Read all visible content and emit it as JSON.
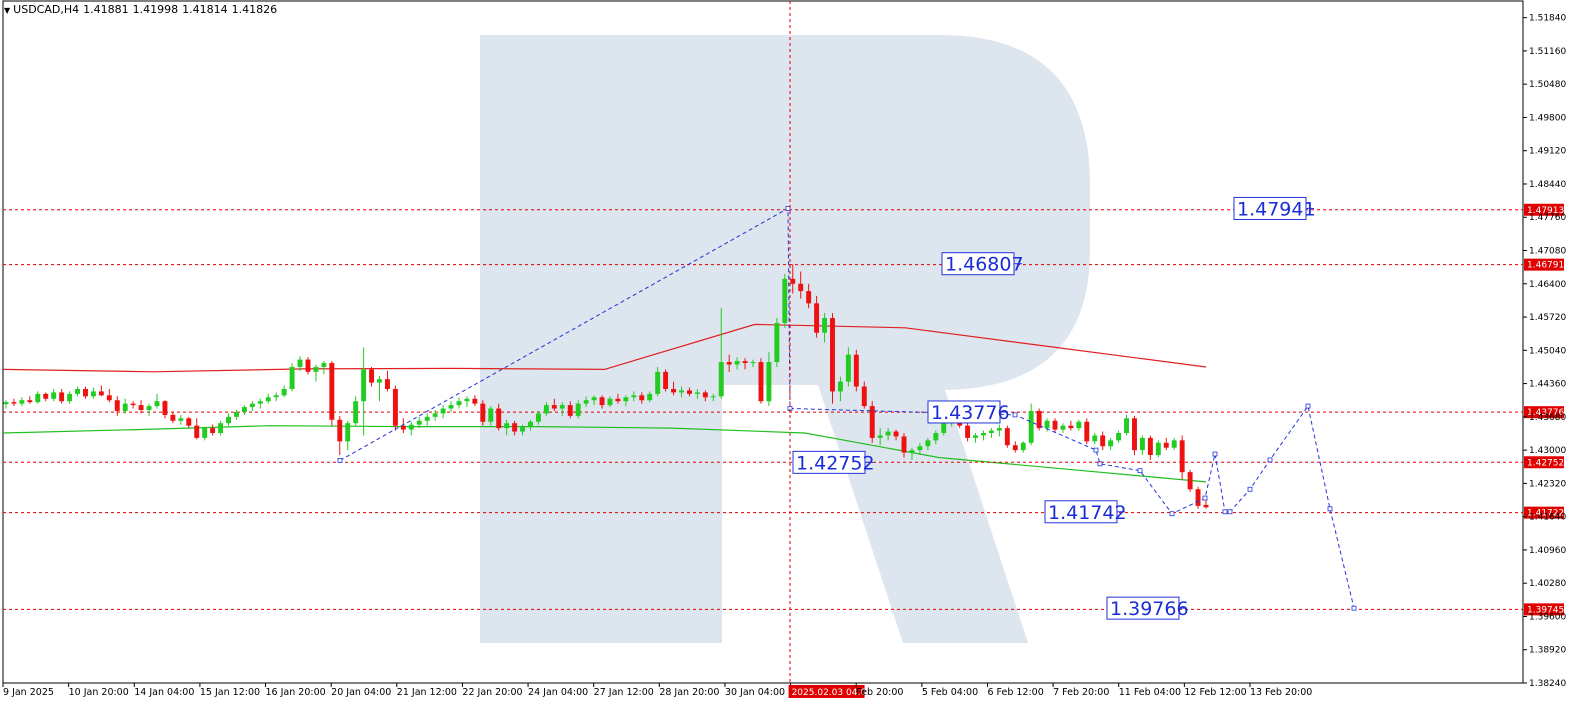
{
  "header": {
    "symbol": "USDCAD,H4",
    "open": "1.41881",
    "high": "1.41998",
    "low": "1.41814",
    "close": "1.41826"
  },
  "chart_data": {
    "type": "candlestick",
    "symbol": "USDCAD",
    "timeframe": "H4",
    "ylim": [
      1.3824,
      1.5218
    ],
    "y_ticks": [
      "1.51840",
      "1.51160",
      "1.50480",
      "1.49800",
      "1.49120",
      "1.48440",
      "1.47760",
      "1.47080",
      "1.46400",
      "1.45720",
      "1.45040",
      "1.44360",
      "1.43680",
      "1.43000",
      "1.42320",
      "1.41640",
      "1.40960",
      "1.40280",
      "1.39600",
      "1.38920",
      "1.38240"
    ],
    "x_ticks": [
      "9 Jan 2025",
      "10 Jan 20:00",
      "14 Jan 04:00",
      "15 Jan 12:00",
      "16 Jan 20:00",
      "20 Jan 04:00",
      "21 Jan 12:00",
      "22 Jan 20:00",
      "24 Jan 04:00",
      "27 Jan 12:00",
      "28 Jan 20:00",
      "30 Jan 04:00",
      "2025.02.03 04:00",
      "Feb 20:00",
      "5 Feb 04:00",
      "6 Feb 12:00",
      "7 Feb 20:00",
      "11 Feb 04:00",
      "12 Feb 12:00",
      "13 Feb 20:00"
    ],
    "crosshair_time": "2025.02.03 04:00",
    "horizontal_levels": [
      {
        "price": 1.47913,
        "tag": "1.47913"
      },
      {
        "price": 1.46791,
        "tag": "1.46791"
      },
      {
        "price": 1.43776,
        "tag": "1.43776"
      },
      {
        "price": 1.42752,
        "tag": "1.42752"
      },
      {
        "price": 1.41722,
        "tag": "1.41722"
      },
      {
        "price": 1.39745,
        "tag": "1.39745"
      }
    ],
    "annotations": [
      {
        "label": "1.47941",
        "price": 1.4794
      },
      {
        "label": "1.46807",
        "price": 1.4681
      },
      {
        "label": "1.43776",
        "price": 1.4378
      },
      {
        "label": "1.42752",
        "price": 1.4275
      },
      {
        "label": "1.41742",
        "price": 1.4174
      },
      {
        "label": "1.39766",
        "price": 1.3977
      }
    ],
    "forecast_path": [
      1.4279,
      1.4794,
      1.4385,
      1.4372,
      1.43,
      1.4272,
      1.4258,
      1.417,
      1.4202,
      1.4292,
      1.4174,
      1.4174,
      1.422,
      1.428,
      1.439,
      1.418,
      1.3977
    ],
    "moving_averages": [
      {
        "color": "#e02020",
        "values": [
          1.4465,
          1.446,
          1.4466,
          1.4467,
          1.4465,
          1.4557,
          1.455,
          1.451,
          1.447
        ]
      },
      {
        "color": "#1fbf1f",
        "values": [
          1.4335,
          1.4342,
          1.435,
          1.4348,
          1.4348,
          1.4345,
          1.4335,
          1.4285,
          1.426,
          1.4235
        ]
      }
    ],
    "colors": {
      "bull": "#22cc22",
      "bear": "#ee1111",
      "level": "#e00000",
      "forecast": "#2233dd",
      "crosshair": "#e00000",
      "watermark": "#dde5ef"
    },
    "candles": [
      [
        1.4394,
        1.4402,
        1.4385,
        1.4398
      ],
      [
        1.4398,
        1.4405,
        1.439,
        1.4395
      ],
      [
        1.4395,
        1.4408,
        1.439,
        1.4402
      ],
      [
        1.4402,
        1.441,
        1.4395,
        1.4398
      ],
      [
        1.4398,
        1.442,
        1.4395,
        1.4415
      ],
      [
        1.4415,
        1.4418,
        1.44,
        1.4405
      ],
      [
        1.4405,
        1.4425,
        1.44,
        1.4418
      ],
      [
        1.4418,
        1.4425,
        1.4395,
        1.44
      ],
      [
        1.44,
        1.442,
        1.4395,
        1.4415
      ],
      [
        1.4415,
        1.443,
        1.441,
        1.4425
      ],
      [
        1.4425,
        1.443,
        1.4405,
        1.441
      ],
      [
        1.441,
        1.4428,
        1.4405,
        1.442
      ],
      [
        1.442,
        1.4432,
        1.441,
        1.4412
      ],
      [
        1.4412,
        1.4425,
        1.4398,
        1.4402
      ],
      [
        1.4402,
        1.441,
        1.437,
        1.438
      ],
      [
        1.438,
        1.4405,
        1.4375,
        1.4395
      ],
      [
        1.4395,
        1.44,
        1.4385,
        1.4392
      ],
      [
        1.4392,
        1.4402,
        1.4375,
        1.4382
      ],
      [
        1.4382,
        1.4395,
        1.437,
        1.439
      ],
      [
        1.439,
        1.4415,
        1.4385,
        1.44
      ],
      [
        1.44,
        1.4402,
        1.4365,
        1.4372
      ],
      [
        1.4372,
        1.4378,
        1.4355,
        1.436
      ],
      [
        1.436,
        1.4372,
        1.4352,
        1.4365
      ],
      [
        1.4365,
        1.4368,
        1.4345,
        1.435
      ],
      [
        1.435,
        1.4365,
        1.4322,
        1.4325
      ],
      [
        1.4325,
        1.4348,
        1.432,
        1.4345
      ],
      [
        1.4345,
        1.4352,
        1.433,
        1.4335
      ],
      [
        1.4335,
        1.436,
        1.433,
        1.4355
      ],
      [
        1.4355,
        1.4375,
        1.435,
        1.4368
      ],
      [
        1.4368,
        1.4382,
        1.4362,
        1.4378
      ],
      [
        1.4378,
        1.4392,
        1.4372,
        1.4388
      ],
      [
        1.4388,
        1.44,
        1.438,
        1.4395
      ],
      [
        1.4395,
        1.4405,
        1.4385,
        1.44
      ],
      [
        1.44,
        1.4415,
        1.4395,
        1.4408
      ],
      [
        1.4408,
        1.4418,
        1.44,
        1.4412
      ],
      [
        1.4412,
        1.4432,
        1.4408,
        1.4425
      ],
      [
        1.4425,
        1.4478,
        1.442,
        1.447
      ],
      [
        1.447,
        1.4492,
        1.4462,
        1.4485
      ],
      [
        1.4485,
        1.449,
        1.4455,
        1.446
      ],
      [
        1.446,
        1.4475,
        1.444,
        1.447
      ],
      [
        1.447,
        1.4482,
        1.4455,
        1.4478
      ],
      [
        1.4478,
        1.4482,
        1.435,
        1.4362
      ],
      [
        1.4362,
        1.437,
        1.429,
        1.4318
      ],
      [
        1.4318,
        1.436,
        1.43,
        1.4355
      ],
      [
        1.4355,
        1.441,
        1.435,
        1.44
      ],
      [
        1.44,
        1.451,
        1.433,
        1.4465
      ],
      [
        1.4465,
        1.447,
        1.443,
        1.4438
      ],
      [
        1.4438,
        1.4452,
        1.44,
        1.4445
      ],
      [
        1.4445,
        1.4462,
        1.442,
        1.4425
      ],
      [
        1.4425,
        1.4432,
        1.434,
        1.435
      ],
      [
        1.435,
        1.4365,
        1.4335,
        1.4342
      ],
      [
        1.4342,
        1.4358,
        1.433,
        1.4352
      ],
      [
        1.4352,
        1.4368,
        1.4345,
        1.436
      ],
      [
        1.436,
        1.4375,
        1.435,
        1.4368
      ],
      [
        1.4368,
        1.4382,
        1.436,
        1.4375
      ],
      [
        1.4375,
        1.4392,
        1.4365,
        1.4385
      ],
      [
        1.4385,
        1.44,
        1.4378,
        1.4392
      ],
      [
        1.4392,
        1.4408,
        1.4385,
        1.44
      ],
      [
        1.44,
        1.441,
        1.4388,
        1.4405
      ],
      [
        1.4405,
        1.4412,
        1.439,
        1.4395
      ],
      [
        1.4395,
        1.4402,
        1.435,
        1.4358
      ],
      [
        1.4358,
        1.439,
        1.435,
        1.4385
      ],
      [
        1.4385,
        1.4395,
        1.434,
        1.4345
      ],
      [
        1.4345,
        1.4362,
        1.433,
        1.4355
      ],
      [
        1.4355,
        1.436,
        1.433,
        1.4338
      ],
      [
        1.4338,
        1.4352,
        1.433,
        1.4348
      ],
      [
        1.4348,
        1.4362,
        1.434,
        1.4358
      ],
      [
        1.4358,
        1.438,
        1.4352,
        1.4375
      ],
      [
        1.4375,
        1.4398,
        1.437,
        1.4392
      ],
      [
        1.4392,
        1.4405,
        1.438,
        1.4385
      ],
      [
        1.4385,
        1.4398,
        1.437,
        1.4392
      ],
      [
        1.4392,
        1.44,
        1.4365,
        1.437
      ],
      [
        1.437,
        1.4402,
        1.4365,
        1.4395
      ],
      [
        1.4395,
        1.441,
        1.4388,
        1.4402
      ],
      [
        1.4402,
        1.4412,
        1.4392,
        1.4408
      ],
      [
        1.4408,
        1.4412,
        1.4385,
        1.4392
      ],
      [
        1.4392,
        1.441,
        1.4388,
        1.4405
      ],
      [
        1.4405,
        1.4415,
        1.4395,
        1.44
      ],
      [
        1.44,
        1.4412,
        1.439,
        1.4408
      ],
      [
        1.4408,
        1.442,
        1.44,
        1.4412
      ],
      [
        1.4412,
        1.4418,
        1.4395,
        1.4402
      ],
      [
        1.4402,
        1.442,
        1.4398,
        1.4415
      ],
      [
        1.4415,
        1.447,
        1.441,
        1.446
      ],
      [
        1.446,
        1.4465,
        1.442,
        1.4425
      ],
      [
        1.4425,
        1.444,
        1.4412,
        1.4418
      ],
      [
        1.4418,
        1.443,
        1.4408,
        1.4422
      ],
      [
        1.4422,
        1.4428,
        1.441,
        1.4415
      ],
      [
        1.4415,
        1.4425,
        1.4405,
        1.4418
      ],
      [
        1.4418,
        1.4422,
        1.44,
        1.4408
      ],
      [
        1.4408,
        1.4415,
        1.44,
        1.441
      ],
      [
        1.441,
        1.459,
        1.4405,
        1.448
      ],
      [
        1.448,
        1.4495,
        1.446,
        1.4475
      ],
      [
        1.4475,
        1.449,
        1.4465,
        1.4482
      ],
      [
        1.4482,
        1.4488,
        1.4465,
        1.4478
      ],
      [
        1.4478,
        1.4485,
        1.447,
        1.448
      ],
      [
        1.448,
        1.4488,
        1.4395,
        1.44
      ],
      [
        1.44,
        1.45,
        1.439,
        1.448
      ],
      [
        1.448,
        1.457,
        1.447,
        1.456
      ],
      [
        1.456,
        1.466,
        1.455,
        1.465
      ],
      [
        1.465,
        1.468,
        1.462,
        1.464
      ],
      [
        1.464,
        1.4665,
        1.461,
        1.4625
      ],
      [
        1.4625,
        1.464,
        1.459,
        1.46
      ],
      [
        1.46,
        1.4615,
        1.453,
        1.454
      ],
      [
        1.454,
        1.458,
        1.452,
        1.457
      ],
      [
        1.457,
        1.458,
        1.4395,
        1.442
      ],
      [
        1.442,
        1.445,
        1.44,
        1.444
      ],
      [
        1.444,
        1.451,
        1.443,
        1.4495
      ],
      [
        1.4495,
        1.4505,
        1.442,
        1.443
      ],
      [
        1.443,
        1.444,
        1.4385,
        1.439
      ],
      [
        1.439,
        1.44,
        1.4315,
        1.4325
      ],
      [
        1.4325,
        1.4345,
        1.431,
        1.433
      ],
      [
        1.433,
        1.4345,
        1.432,
        1.4338
      ],
      [
        1.4338,
        1.4342,
        1.432,
        1.4328
      ],
      [
        1.4328,
        1.4335,
        1.4285,
        1.4295
      ],
      [
        1.4295,
        1.4305,
        1.428,
        1.43
      ],
      [
        1.43,
        1.4315,
        1.429,
        1.4308
      ],
      [
        1.4308,
        1.4325,
        1.43,
        1.432
      ],
      [
        1.432,
        1.434,
        1.4312,
        1.4335
      ],
      [
        1.4335,
        1.4362,
        1.433,
        1.4355
      ],
      [
        1.4355,
        1.438,
        1.4348,
        1.4372
      ],
      [
        1.4372,
        1.4375,
        1.4345,
        1.435
      ],
      [
        1.435,
        1.436,
        1.4318,
        1.4325
      ],
      [
        1.4325,
        1.4335,
        1.4315,
        1.433
      ],
      [
        1.433,
        1.434,
        1.432,
        1.4335
      ],
      [
        1.4335,
        1.4345,
        1.4325,
        1.434
      ],
      [
        1.434,
        1.4352,
        1.4328,
        1.4345
      ],
      [
        1.4345,
        1.435,
        1.4305,
        1.431
      ],
      [
        1.431,
        1.4318,
        1.4295,
        1.43
      ],
      [
        1.43,
        1.4318,
        1.4295,
        1.4315
      ],
      [
        1.4315,
        1.4395,
        1.431,
        1.438
      ],
      [
        1.438,
        1.4385,
        1.434,
        1.4345
      ],
      [
        1.4345,
        1.4365,
        1.4338,
        1.436
      ],
      [
        1.436,
        1.4365,
        1.4335,
        1.4342
      ],
      [
        1.4342,
        1.4355,
        1.4335,
        1.435
      ],
      [
        1.435,
        1.436,
        1.434,
        1.4345
      ],
      [
        1.4345,
        1.4362,
        1.434,
        1.4358
      ],
      [
        1.4358,
        1.4365,
        1.4312,
        1.4318
      ],
      [
        1.4318,
        1.4335,
        1.4312,
        1.433
      ],
      [
        1.433,
        1.4338,
        1.43,
        1.4308
      ],
      [
        1.4308,
        1.4325,
        1.43,
        1.432
      ],
      [
        1.432,
        1.434,
        1.4315,
        1.4335
      ],
      [
        1.4335,
        1.4372,
        1.433,
        1.4365
      ],
      [
        1.4365,
        1.437,
        1.429,
        1.43
      ],
      [
        1.43,
        1.433,
        1.429,
        1.4325
      ],
      [
        1.4325,
        1.433,
        1.428,
        1.429
      ],
      [
        1.429,
        1.432,
        1.4285,
        1.4315
      ],
      [
        1.4315,
        1.4325,
        1.43,
        1.4305
      ],
      [
        1.4305,
        1.4325,
        1.43,
        1.432
      ],
      [
        1.432,
        1.433,
        1.424,
        1.4255
      ],
      [
        1.4255,
        1.426,
        1.4215,
        1.422
      ],
      [
        1.422,
        1.4225,
        1.418,
        1.4186
      ],
      [
        1.4188,
        1.42,
        1.4181,
        1.4183
      ]
    ]
  }
}
